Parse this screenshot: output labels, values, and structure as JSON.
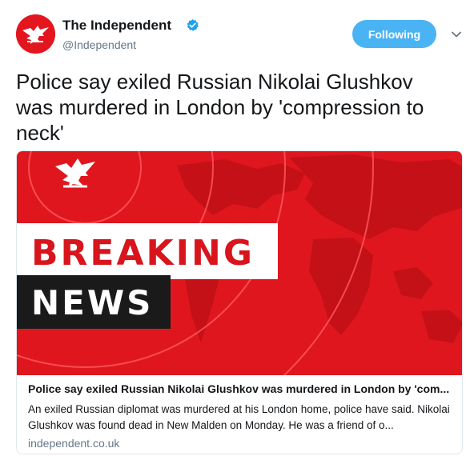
{
  "account": {
    "name": "The Independent",
    "handle": "@Independent",
    "verified": true
  },
  "follow_button": {
    "label": "Following"
  },
  "tweet": {
    "text": "Police say exiled Russian Nikolai Glushkov was murdered in London by 'compression to neck'"
  },
  "card": {
    "image_text_line1": "BREAKING",
    "image_text_line2": "NEWS",
    "title": "Police say exiled Russian Nikolai Glushkov was murdered in London by 'com...",
    "description": "An exiled Russian diplomat was murdered at his London home, police have said. Nikolai Glushkov was found dead in New Malden on Monday. He was a friend of o...",
    "domain": "independent.co.uk"
  },
  "colors": {
    "brand_red": "#e3151f",
    "follow_blue": "#4ab3f4",
    "verified_blue": "#1da1f2",
    "secondary_text": "#657786"
  },
  "icons": {
    "avatar": "eagle-logo-icon",
    "verified": "verified-badge-icon",
    "caret": "chevron-down-icon"
  }
}
